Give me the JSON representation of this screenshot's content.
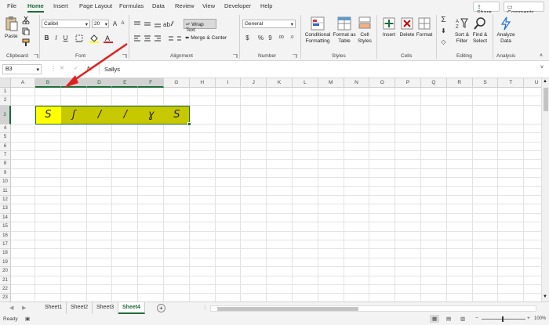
{
  "menu": {
    "tabs": [
      "File",
      "Home",
      "Insert",
      "Page Layout",
      "Formulas",
      "Data",
      "Review",
      "View",
      "Developer",
      "Help"
    ],
    "share": "Share",
    "comments": "Comments"
  },
  "ribbon": {
    "clipboard": {
      "paste": "Paste",
      "label": "Clipboard"
    },
    "font": {
      "name": "Calibri",
      "size": "20",
      "bold": "B",
      "italic": "I",
      "underline": "U",
      "grow": "A",
      "shrink": "A",
      "label": "Font"
    },
    "alignment": {
      "wrap": "Wrap Text",
      "merge": "Merge & Center",
      "label": "Alignment"
    },
    "number": {
      "format": "General",
      "currency": "$",
      "percent": "%",
      "comma": "9",
      "inc": ".00",
      "dec": ".0",
      "label": "Number"
    },
    "styles": {
      "conditional": [
        "Conditional",
        "Formatting"
      ],
      "format_table": [
        "Format as",
        "Table"
      ],
      "cell_styles": [
        "Cell",
        "Styles"
      ],
      "label": "Styles"
    },
    "cells": {
      "insert": "Insert",
      "delete": "Delete",
      "format": "Format",
      "label": "Cells"
    },
    "editing": {
      "sort": [
        "Sort &",
        "Filter"
      ],
      "find": [
        "Find &",
        "Select"
      ],
      "label": "Editing"
    },
    "analysis": {
      "analyze": [
        "Analyze",
        "Data"
      ],
      "label": "Analysis"
    }
  },
  "formula_bar": {
    "name_box": "B3",
    "cancel": "✕",
    "enter": "✓",
    "fx": "fx",
    "value": "Sallys"
  },
  "grid": {
    "columns": [
      "A",
      "B",
      "C",
      "D",
      "E",
      "F",
      "G",
      "H",
      "I",
      "J",
      "K",
      "L",
      "M",
      "N",
      "O",
      "P",
      "Q",
      "R",
      "S",
      "T",
      "U"
    ],
    "rows": [
      "1",
      "2",
      "3",
      "4",
      "5",
      "6",
      "7",
      "8",
      "9",
      "10",
      "11",
      "12",
      "13",
      "14",
      "15",
      "16",
      "17",
      "18",
      "19",
      "20",
      "21",
      "22",
      "23"
    ],
    "selected_col": "B",
    "selected_row": "3",
    "highlight_color": "#c8c800",
    "active_cell_color": "#ffff00",
    "row3_glyphs": [
      "S",
      "ʃ",
      "/",
      "/",
      "ɣ",
      "S"
    ]
  },
  "sheets": {
    "tabs": [
      "Sheet1",
      "Sheet2",
      "Sheet3",
      "Sheet4"
    ],
    "active": "Sheet4",
    "add": "+"
  },
  "status": {
    "ready": "Ready",
    "zoom": "100%",
    "minus": "−",
    "plus": "+"
  },
  "colors": {
    "accent": "#1d6b3a",
    "arrow": "#e02020"
  }
}
